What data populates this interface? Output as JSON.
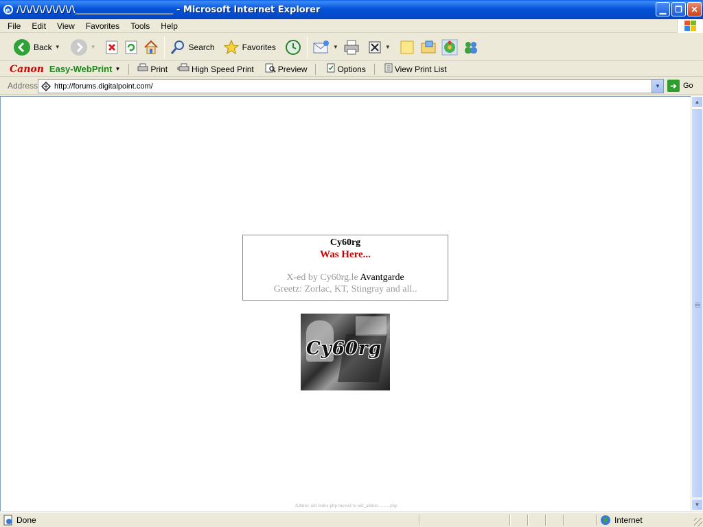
{
  "window": {
    "title": "/\\/\\/\\/\\/\\/\\/\\/\\/\\______________________ - Microsoft Internet Explorer"
  },
  "menu": [
    "File",
    "Edit",
    "View",
    "Favorites",
    "Tools",
    "Help"
  ],
  "toolbar": {
    "back_label": "Back",
    "search_label": "Search",
    "favorites_label": "Favorites"
  },
  "canon_bar": {
    "brand": "Canon",
    "product": "Easy-WebPrint",
    "print_label": "Print",
    "high_speed_print_label": "High Speed Print",
    "preview_label": "Preview",
    "options_label": "Options",
    "view_print_list_label": "View Print List"
  },
  "address_bar": {
    "label": "Address",
    "url": "http://forums.digitalpoint.com/",
    "go_label": "Go"
  },
  "page": {
    "title": "Cy60rg",
    "subtitle": "Was Here...",
    "xed_by_prefix": "X-ed by Cy60rg.le ",
    "xed_by_highlight": "Avantgarde",
    "greetz": "Greetz: Zorlac, KT, Stingray and all..",
    "image_caption": "Cy60rg",
    "footer_note": "Admin: old index.php moved to old_admin..........php"
  },
  "status": {
    "text": "Done",
    "zone": "Internet"
  }
}
